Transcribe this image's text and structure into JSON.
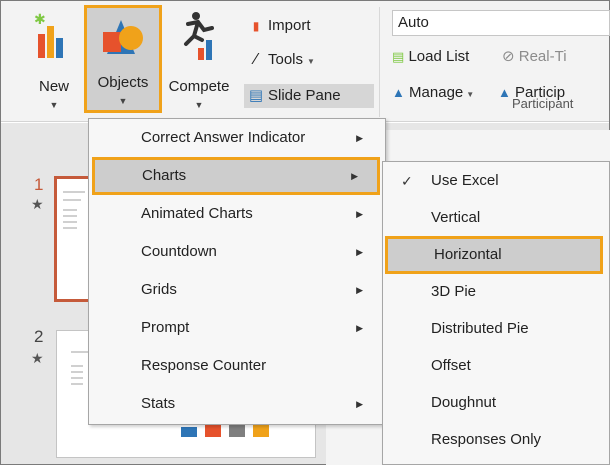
{
  "ribbon": {
    "new_label": "New",
    "objects_label": "Objects",
    "compete_label": "Compete",
    "import_label": "Import",
    "tools_label": "Tools",
    "slide_pane_label": "Slide Pane",
    "auto_value": "Auto",
    "load_list_label": "Load List",
    "realtime_label": "Real-Ti",
    "manage_label": "Manage",
    "participants_label": "Particip",
    "participants_group": "Participant"
  },
  "slides": [
    {
      "number": "1",
      "star": "★"
    },
    {
      "number": "2",
      "star": "★"
    }
  ],
  "objects_menu": {
    "items": [
      {
        "label": "Correct Answer Indicator"
      },
      {
        "label": "Charts"
      },
      {
        "label": "Animated Charts"
      },
      {
        "label": "Countdown"
      },
      {
        "label": "Grids"
      },
      {
        "label": "Prompt"
      },
      {
        "label": "Response Counter"
      },
      {
        "label": "Stats"
      }
    ]
  },
  "charts_submenu": {
    "items": [
      {
        "label": "Use Excel",
        "checked": true
      },
      {
        "label": "Vertical"
      },
      {
        "label": "Horizontal"
      },
      {
        "label": "3D Pie"
      },
      {
        "label": "Distributed Pie"
      },
      {
        "label": "Offset"
      },
      {
        "label": "Doughnut"
      },
      {
        "label": "Responses Only"
      }
    ]
  },
  "colors": {
    "highlight_border": "#f0a21a",
    "selected_slide_border": "#c55a3a"
  }
}
